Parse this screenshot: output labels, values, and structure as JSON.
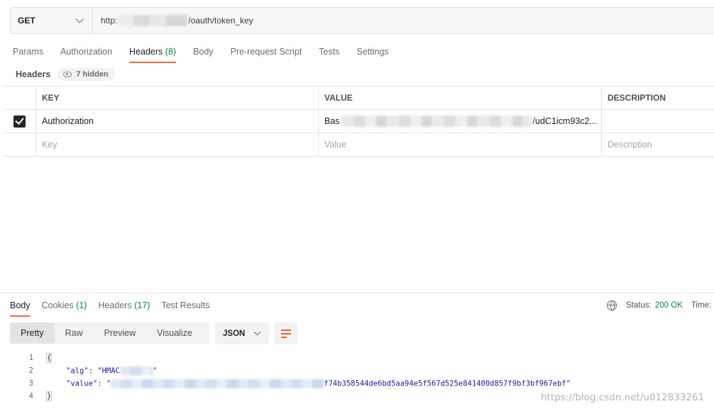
{
  "request": {
    "method": "GET",
    "url_prefix": "http:",
    "url_suffix": "/oauth/token_key"
  },
  "request_tabs": [
    {
      "label": "Params"
    },
    {
      "label": "Authorization"
    },
    {
      "label": "Headers",
      "count": "(8)"
    },
    {
      "label": "Body"
    },
    {
      "label": "Pre-request Script"
    },
    {
      "label": "Tests"
    },
    {
      "label": "Settings"
    }
  ],
  "headers_section": {
    "title": "Headers",
    "hidden_label": "7 hidden"
  },
  "table": {
    "columns": [
      "KEY",
      "VALUE",
      "DESCRIPTION"
    ],
    "row": {
      "key": "Authorization",
      "value_prefix": "Bas",
      "value_suffix": "/udC1icm93c2..."
    },
    "placeholders": {
      "key": "Key",
      "value": "Value",
      "description": "Description"
    }
  },
  "response_tabs": [
    {
      "label": "Body"
    },
    {
      "label": "Cookies",
      "count": "(1)"
    },
    {
      "label": "Headers",
      "count": "(17)"
    },
    {
      "label": "Test Results"
    }
  ],
  "status": {
    "label": "Status:",
    "value": "200 OK",
    "time_label": "Time:"
  },
  "view_modes": [
    "Pretty",
    "Raw",
    "Preview",
    "Visualize"
  ],
  "format": "JSON",
  "code": {
    "line_numbers": [
      "1",
      "2",
      "3",
      "4"
    ],
    "open": "{",
    "alg_key": "\"alg\"",
    "alg_value_prefix": "\"HMAC",
    "alg_value_suffix": "\"",
    "value_key": "\"value\"",
    "value_prefix": "\"",
    "value_suffix": "f74b358544de6bd5aa94e5f567d525e841400d857f9bf3bf967ebf\"",
    "close": "}"
  },
  "watermark": "https://blog.csdn.net/u012833261",
  "colors": {
    "accent": "#f26b3a",
    "count_green": "#0c8a35",
    "json_string": "#1a1aa6"
  }
}
